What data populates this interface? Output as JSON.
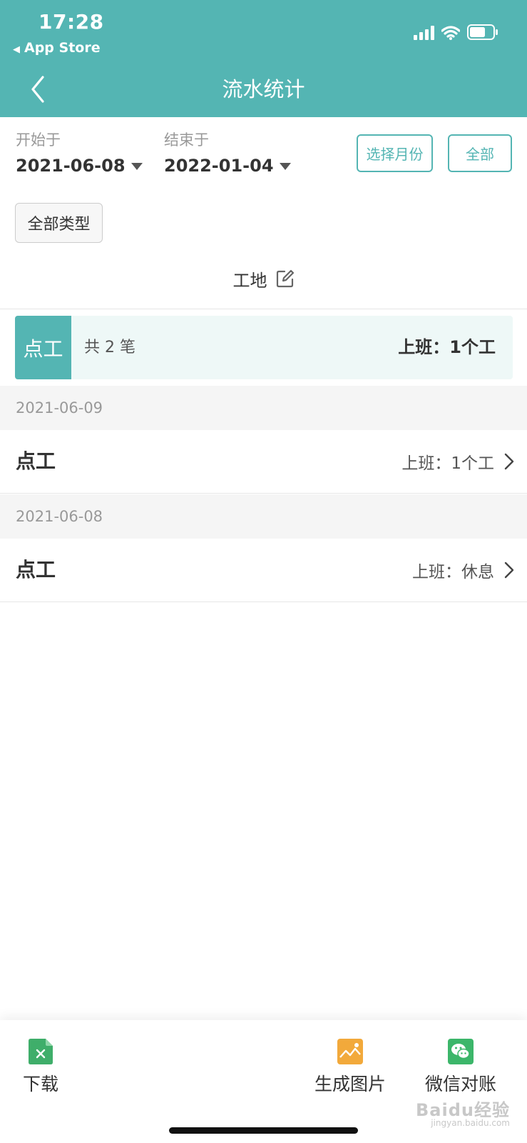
{
  "status_bar": {
    "time": "17:28",
    "back_app": "App Store"
  },
  "nav": {
    "title": "流水统计"
  },
  "filters": {
    "start_label": "开始于",
    "start_date": "2021-06-08",
    "end_label": "结束于",
    "end_date": "2022-01-04",
    "select_month_label": "选择月份",
    "all_label": "全部",
    "type_label": "全部类型",
    "site_label": "工地"
  },
  "summary": {
    "tag": "点工",
    "count": "共 2 笔",
    "attendance": "上班：1个工"
  },
  "groups": [
    {
      "date": "2021-06-09",
      "records": [
        {
          "type": "点工",
          "status": "上班：1个工"
        }
      ]
    },
    {
      "date": "2021-06-08",
      "records": [
        {
          "type": "点工",
          "status": "上班：休息"
        }
      ]
    }
  ],
  "bottom_bar": {
    "download_label": "下载",
    "download_icon": "excel-file-icon",
    "image_label": "生成图片",
    "image_icon": "picture-icon",
    "wechat_label": "微信对账",
    "wechat_icon": "wechat-icon"
  },
  "watermark": {
    "text": "Baidu经验",
    "sub": "jingyan.baidu.com"
  },
  "colors": {
    "primary": "#54b5b3",
    "summary_bg": "#eef8f7",
    "excel_green": "#3fae6a",
    "image_orange": "#f2a93b",
    "wechat_green": "#3cb66a"
  }
}
